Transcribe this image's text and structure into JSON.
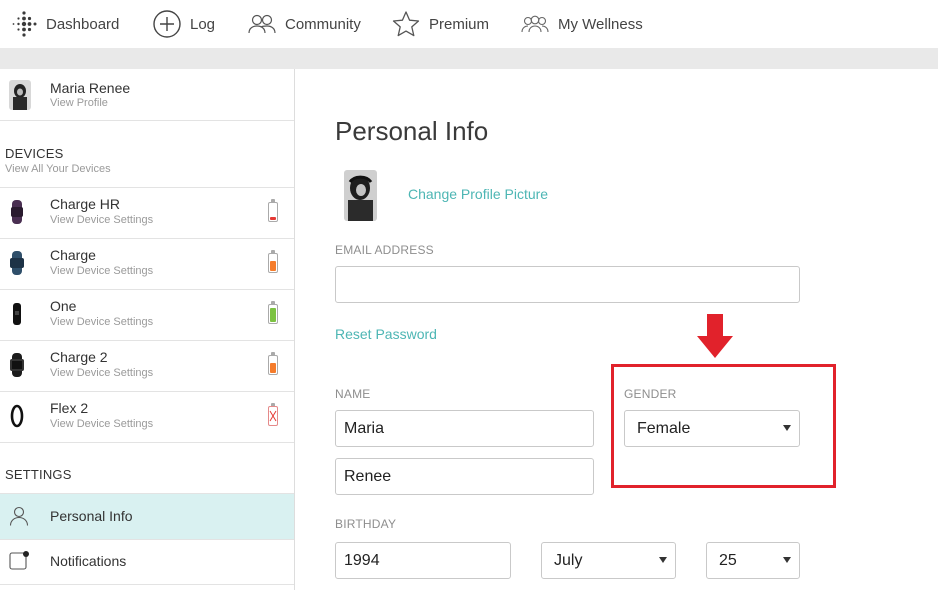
{
  "nav": {
    "dashboard": "Dashboard",
    "log": "Log",
    "community": "Community",
    "premium": "Premium",
    "wellness": "My Wellness"
  },
  "profile": {
    "name": "Maria Renee",
    "link": "View Profile"
  },
  "devices": {
    "title": "DEVICES",
    "subtitle": "View All Your Devices",
    "items": [
      {
        "name": "Charge HR",
        "sub": "View Device Settings",
        "battery_level": 0.2,
        "battery_color": "#e53935"
      },
      {
        "name": "Charge",
        "sub": "View Device Settings",
        "battery_level": 0.65,
        "battery_color": "#f57c2b"
      },
      {
        "name": "One",
        "sub": "View Device Settings",
        "battery_level": 0.85,
        "battery_color": "#7cc242"
      },
      {
        "name": "Charge 2",
        "sub": "View Device Settings",
        "battery_level": 0.65,
        "battery_color": "#f57c2b"
      },
      {
        "name": "Flex 2",
        "sub": "View Device Settings",
        "battery_level": 0,
        "battery_color": "#e53935"
      }
    ]
  },
  "settings": {
    "title": "SETTINGS",
    "items": [
      {
        "label": "Personal Info",
        "active": true
      },
      {
        "label": "Notifications",
        "active": false
      }
    ]
  },
  "main": {
    "title": "Personal Info",
    "change_picture": "Change Profile Picture",
    "email_label": "EMAIL ADDRESS",
    "email_value": "",
    "reset_password": "Reset Password",
    "name_label": "NAME",
    "first_name": "Maria",
    "last_name": "Renee",
    "gender_label": "GENDER",
    "gender_value": "Female",
    "birthday_label": "BIRTHDAY",
    "birth_year": "1994",
    "birth_month": "July",
    "birth_day": "25"
  },
  "colors": {
    "accent": "#4db6b4",
    "highlight": "#e1222b",
    "active_row": "#d9f1f1"
  }
}
